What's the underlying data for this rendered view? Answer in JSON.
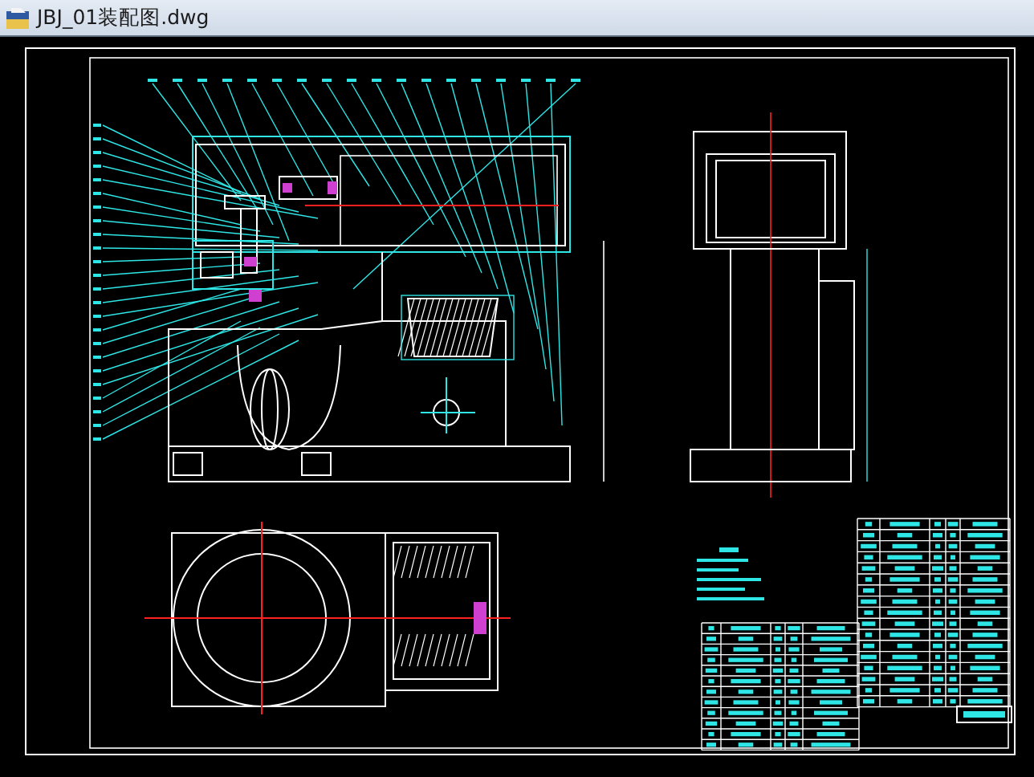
{
  "window": {
    "title": "JBJ_01装配图.dwg"
  }
}
